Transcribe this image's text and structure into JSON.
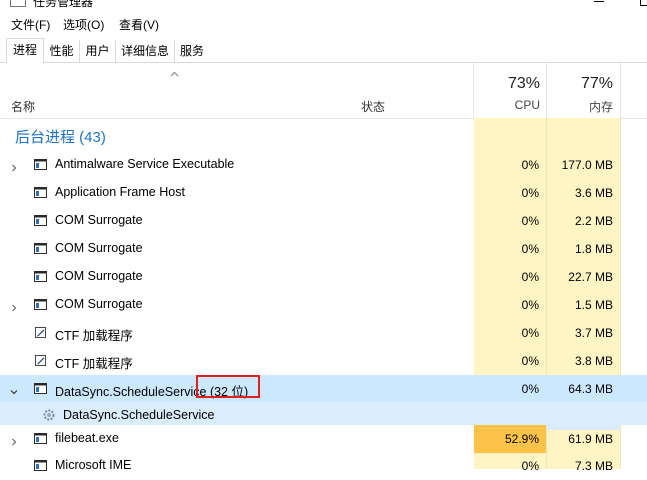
{
  "window": {
    "title": "任务管理器",
    "icon": "task-manager-icon"
  },
  "menu": {
    "items": [
      "文件(F)",
      "选项(O)",
      "查看(V)"
    ]
  },
  "tabs": [
    {
      "label": "进程",
      "active": true
    },
    {
      "label": "性能",
      "active": false
    },
    {
      "label": "用户",
      "active": false
    },
    {
      "label": "详细信息",
      "active": false
    },
    {
      "label": "服务",
      "active": false
    }
  ],
  "columns": {
    "name": "名称",
    "status": "状态",
    "cpu": {
      "pct": "73%",
      "label": "CPU"
    },
    "mem": {
      "pct": "77%",
      "label": "内存"
    }
  },
  "group": {
    "title": "后台进程 (43)"
  },
  "rows": [
    {
      "name": "Antimalware Service Executable",
      "cpu": "0%",
      "mem": "177.0 MB",
      "expander": true,
      "icon": "app-window-icon"
    },
    {
      "name": "Application Frame Host",
      "cpu": "0%",
      "mem": "3.6 MB",
      "expander": false,
      "icon": "app-window-icon"
    },
    {
      "name": "COM Surrogate",
      "cpu": "0%",
      "mem": "2.2 MB",
      "expander": false,
      "icon": "app-window-icon"
    },
    {
      "name": "COM Surrogate",
      "cpu": "0%",
      "mem": "1.8 MB",
      "expander": false,
      "icon": "app-window-icon"
    },
    {
      "name": "COM Surrogate",
      "cpu": "0%",
      "mem": "22.7 MB",
      "expander": false,
      "icon": "app-window-icon"
    },
    {
      "name": "COM Surrogate",
      "cpu": "0%",
      "mem": "1.5 MB",
      "expander": true,
      "icon": "app-window-icon"
    },
    {
      "name": "CTF 加载程序",
      "cpu": "0%",
      "mem": "3.7 MB",
      "expander": false,
      "icon": "pen-edit-icon"
    },
    {
      "name": "CTF 加载程序",
      "cpu": "0%",
      "mem": "3.8 MB",
      "expander": false,
      "icon": "pen-edit-icon"
    },
    {
      "name": "DataSync.ScheduleService (32 位)",
      "cpu": "0%",
      "mem": "64.3 MB",
      "expander": true,
      "expanded": true,
      "selected": true,
      "icon": "app-window-icon"
    },
    {
      "name": "DataSync.ScheduleService",
      "cpu": "",
      "mem": "",
      "child": true,
      "icon": "service-gear-icon"
    },
    {
      "name": "filebeat.exe",
      "cpu": "52.9%",
      "mem": "61.9 MB",
      "expander": true,
      "icon": "app-window-icon",
      "cpu_hot": true
    },
    {
      "name": "Microsoft IME",
      "cpu": "0%",
      "mem": "7.3 MB",
      "expander": false,
      "icon": "app-window-icon"
    }
  ],
  "colors": {
    "accent": "#1e73be",
    "heat_low": "#fff4c4",
    "heat_high": "#fcc34a",
    "selection": "#cce8ff",
    "highlight_box": "#e0201f"
  }
}
